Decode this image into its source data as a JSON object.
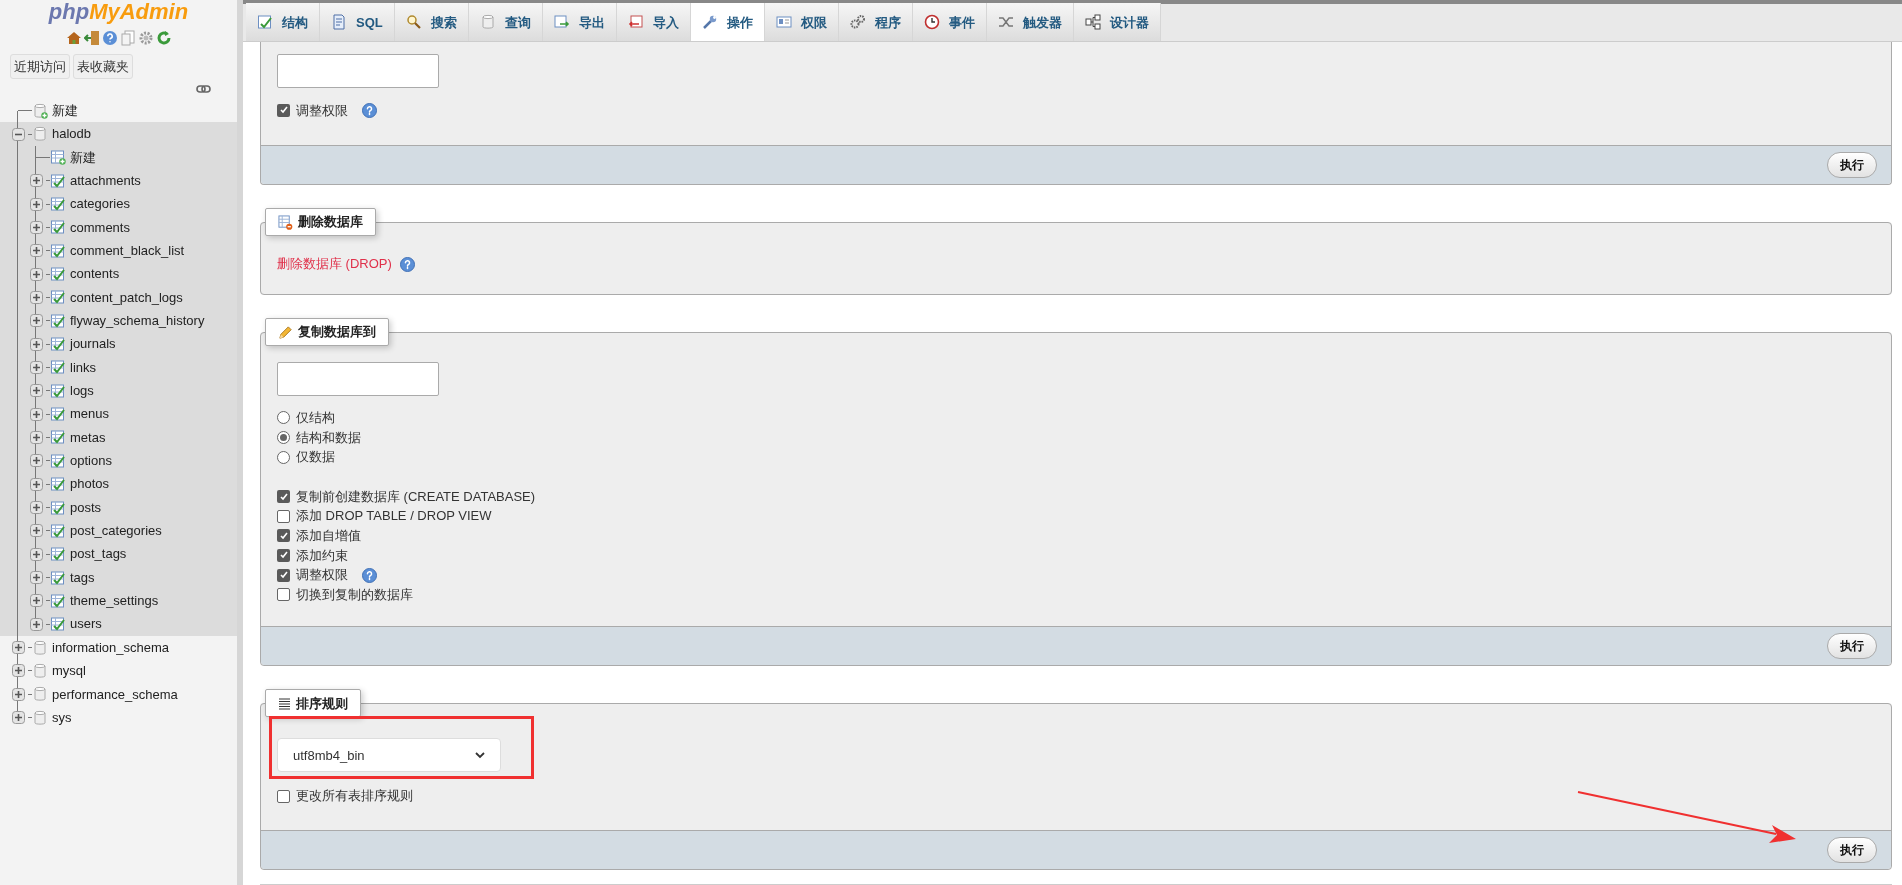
{
  "sidebar": {
    "logo": {
      "left": "php",
      "right": "MyAdmin"
    },
    "nav_icons": [
      {
        "kind": "home"
      },
      {
        "kind": "exit"
      },
      {
        "kind": "help"
      },
      {
        "kind": "docs"
      },
      {
        "kind": "settings"
      },
      {
        "kind": "reload"
      }
    ],
    "buttons": [
      "近期访问",
      "表收藏夹"
    ],
    "tree": [
      {
        "label": "新建",
        "kind": "new_db"
      },
      {
        "label": "halodb",
        "kind": "db",
        "expanded": true,
        "children": [
          {
            "label": "新建",
            "kind": "new_table"
          },
          {
            "label": "attachments",
            "kind": "table",
            "expanded": false
          },
          {
            "label": "categories",
            "kind": "table",
            "expanded": false
          },
          {
            "label": "comments",
            "kind": "table",
            "expanded": false
          },
          {
            "label": "comment_black_list",
            "kind": "table",
            "expanded": false
          },
          {
            "label": "contents",
            "kind": "table",
            "expanded": false
          },
          {
            "label": "content_patch_logs",
            "kind": "table",
            "expanded": false
          },
          {
            "label": "flyway_schema_history",
            "kind": "table",
            "expanded": false
          },
          {
            "label": "journals",
            "kind": "table",
            "expanded": false
          },
          {
            "label": "links",
            "kind": "table",
            "expanded": false
          },
          {
            "label": "logs",
            "kind": "table",
            "expanded": false
          },
          {
            "label": "menus",
            "kind": "table",
            "expanded": false
          },
          {
            "label": "metas",
            "kind": "table",
            "expanded": false
          },
          {
            "label": "options",
            "kind": "table",
            "expanded": false
          },
          {
            "label": "photos",
            "kind": "table",
            "expanded": false
          },
          {
            "label": "posts",
            "kind": "table",
            "expanded": false
          },
          {
            "label": "post_categories",
            "kind": "table",
            "expanded": false
          },
          {
            "label": "post_tags",
            "kind": "table",
            "expanded": false
          },
          {
            "label": "tags",
            "kind": "table",
            "expanded": false
          },
          {
            "label": "theme_settings",
            "kind": "table",
            "expanded": false
          },
          {
            "label": "users",
            "kind": "table",
            "expanded": false
          }
        ]
      },
      {
        "label": "information_schema",
        "kind": "db",
        "expanded": false
      },
      {
        "label": "mysql",
        "kind": "db",
        "expanded": false
      },
      {
        "label": "performance_schema",
        "kind": "db",
        "expanded": false
      },
      {
        "label": "sys",
        "kind": "db",
        "expanded": false
      }
    ]
  },
  "tabs": [
    {
      "label": "结构",
      "kind": "structure",
      "selected": false
    },
    {
      "label": "SQL",
      "kind": "sql",
      "selected": false
    },
    {
      "label": "搜索",
      "kind": "search",
      "selected": false
    },
    {
      "label": "查询",
      "kind": "query",
      "selected": false
    },
    {
      "label": "导出",
      "kind": "export",
      "selected": false
    },
    {
      "label": "导入",
      "kind": "import",
      "selected": false
    },
    {
      "label": "操作",
      "kind": "operations",
      "selected": true
    },
    {
      "label": "权限",
      "kind": "privileges",
      "selected": false
    },
    {
      "label": "程序",
      "kind": "routines",
      "selected": false
    },
    {
      "label": "事件",
      "kind": "events",
      "selected": false
    },
    {
      "label": "触发器",
      "kind": "triggers",
      "selected": false
    },
    {
      "label": "设计器",
      "kind": "designer",
      "selected": false
    }
  ],
  "sections": [
    {
      "items": [
        {
          "kind": "input"
        },
        {
          "kind": "checkbox",
          "label": "调整权限",
          "checked": true,
          "help": true
        }
      ],
      "submit": "执行"
    },
    {
      "legend": "删除数据库",
      "kind": "drop",
      "items": [
        {
          "kind": "link",
          "label": "删除数据库 (DROP)",
          "help": true
        }
      ]
    },
    {
      "legend": "复制数据库到",
      "kind": "copy",
      "items": [
        {
          "kind": "input"
        },
        {
          "kind": "radio",
          "label": "仅结构",
          "selected": false
        },
        {
          "kind": "radio",
          "label": "结构和数据",
          "selected": true
        },
        {
          "kind": "radio",
          "label": "仅数据",
          "selected": false
        },
        {
          "kind": "spacer"
        },
        {
          "kind": "checkbox",
          "label": "复制前创建数据库 (CREATE DATABASE)",
          "checked": true
        },
        {
          "kind": "checkbox",
          "label": "添加 DROP TABLE / DROP VIEW",
          "checked": false
        },
        {
          "kind": "checkbox",
          "label": "添加自增值",
          "checked": true
        },
        {
          "kind": "checkbox",
          "label": "添加约束",
          "checked": true
        },
        {
          "kind": "checkbox",
          "label": "调整权限",
          "checked": true,
          "help": true
        },
        {
          "kind": "checkbox",
          "label": "切换到复制的数据库",
          "checked": false
        }
      ],
      "submit": "执行"
    },
    {
      "legend": "排序规则",
      "kind": "collation",
      "items": [
        {
          "kind": "select",
          "value": "utf8mb4_bin"
        },
        {
          "kind": "checkbox",
          "label": "更改所有表排序规则",
          "checked": false
        }
      ],
      "submit": "执行"
    }
  ]
}
